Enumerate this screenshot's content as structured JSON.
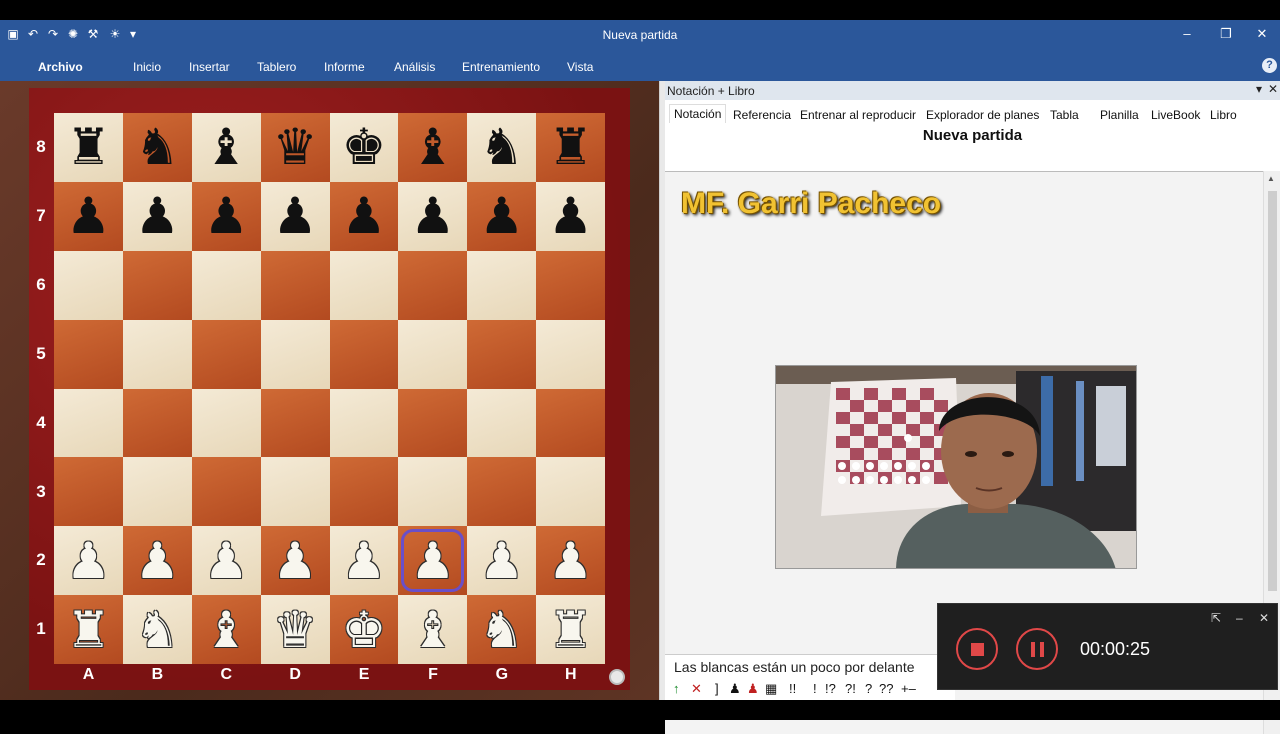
{
  "window": {
    "title": "Nueva partida",
    "minimize": "–",
    "restore": "❐",
    "close": "✕"
  },
  "quick_access": [
    "save",
    "undo",
    "redo",
    "engine",
    "tools",
    "bulb",
    "more"
  ],
  "ribbon": {
    "tabs": [
      "Archivo",
      "Inicio",
      "Insertar",
      "Tablero",
      "Informe",
      "Análisis",
      "Entrenamiento",
      "Vista"
    ]
  },
  "board": {
    "ranks": [
      "8",
      "7",
      "6",
      "5",
      "4",
      "3",
      "2",
      "1"
    ],
    "files": [
      "A",
      "B",
      "C",
      "D",
      "E",
      "F",
      "G",
      "H"
    ],
    "position": [
      [
        "r",
        "n",
        "b",
        "q",
        "k",
        "b",
        "n",
        "r"
      ],
      [
        "p",
        "p",
        "p",
        "p",
        "p",
        "p",
        "p",
        "p"
      ],
      [
        "",
        "",
        "",
        "",
        "",
        "",
        "",
        ""
      ],
      [
        "",
        "",
        "",
        "",
        "",
        "",
        "",
        ""
      ],
      [
        "",
        "",
        "",
        "",
        "",
        "",
        "",
        ""
      ],
      [
        "",
        "",
        "",
        "",
        "",
        "",
        "",
        ""
      ],
      [
        "P",
        "P",
        "P",
        "P",
        "P",
        "P",
        "P",
        "P"
      ],
      [
        "R",
        "N",
        "B",
        "Q",
        "K",
        "B",
        "N",
        "R"
      ]
    ],
    "highlighted_square": "f2",
    "colors": {
      "light": "#efe4cc",
      "dark": "#c45a2c",
      "frame": "#8b1818",
      "highlight": "#6a4fc8"
    }
  },
  "notation_pane": {
    "header": "Notación + Libro",
    "tabs": [
      "Notación",
      "Referencia",
      "Entrenar al reproducir",
      "Explorador de planes",
      "Tabla",
      "Planilla",
      "LiveBook",
      "Libro"
    ],
    "active_tab": "Notación",
    "game_title": "Nueva partida",
    "author_overlay": "MF. Garri Pacheco",
    "evaluation_text": "Las blancas están un poco por delante",
    "symbols": [
      "↑",
      "✕",
      "]",
      "♟",
      "♟",
      "▦",
      "!!",
      "!",
      "!?",
      "?!",
      "?",
      "??",
      "+–"
    ]
  },
  "recorder": {
    "time": "00:00:25",
    "accent": "#e04848"
  }
}
